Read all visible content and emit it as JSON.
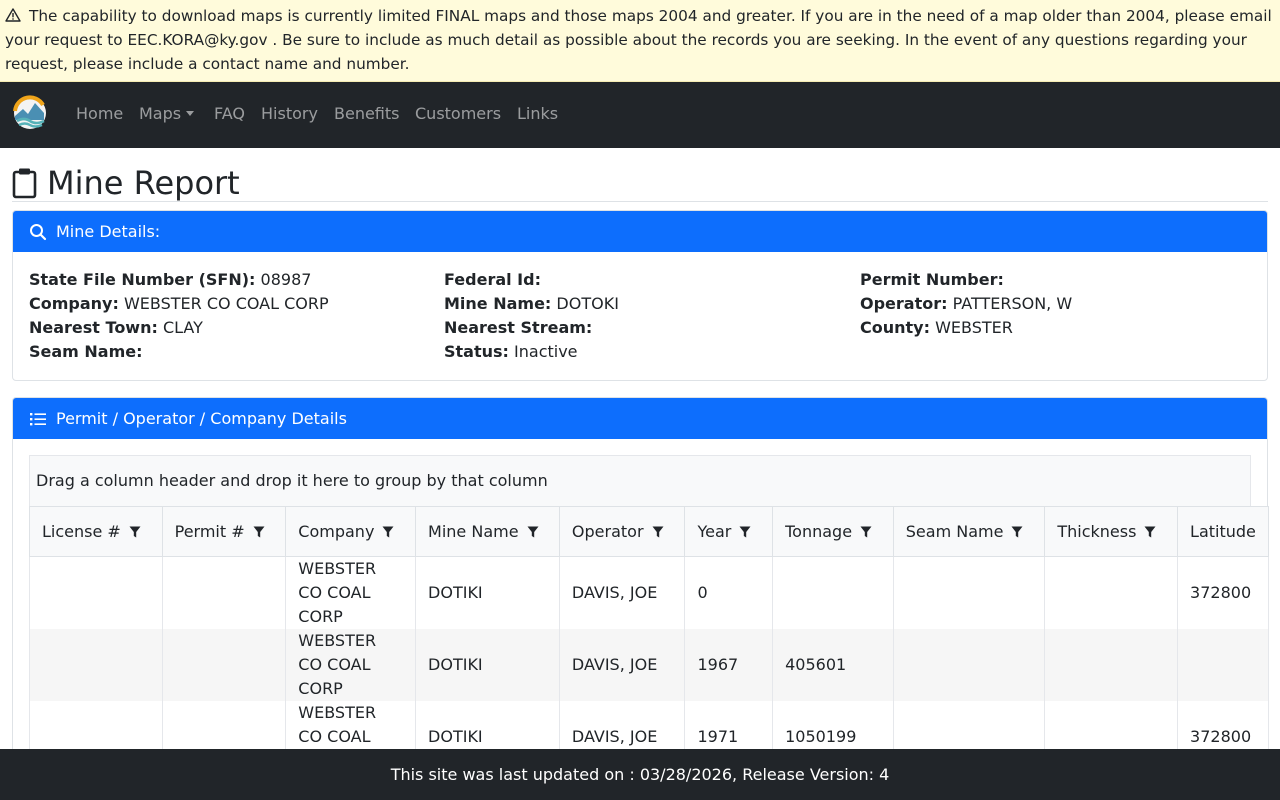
{
  "alert": {
    "icon": "warning-triangle-icon",
    "text": "The capability to download maps is currently limited FINAL maps and those maps 2004 and greater. If you are in the need of a map older than 2004, please email your request to EEC.KORA@ky.gov . Be sure to include as much detail as possible about the records you are seeking. In the event of any questions regarding your request, please include a contact name and number."
  },
  "nav": {
    "items": [
      {
        "label": "Home"
      },
      {
        "label": "Maps"
      },
      {
        "label": "FAQ"
      },
      {
        "label": "History"
      },
      {
        "label": "Benefits"
      },
      {
        "label": "Customers"
      },
      {
        "label": "Links"
      }
    ]
  },
  "page": {
    "title": "Mine Report",
    "title_icon": "clipboard-icon"
  },
  "mine_details": {
    "header": "Mine Details:",
    "fields": [
      {
        "label": "State File Number (SFN):",
        "value": "08987"
      },
      {
        "label": "Company:",
        "value": "WEBSTER CO COAL CORP"
      },
      {
        "label": "Nearest Town:",
        "value": "CLAY"
      },
      {
        "label": "Seam Name:",
        "value": ""
      },
      {
        "label": "Federal Id:",
        "value": ""
      },
      {
        "label": "Mine Name:",
        "value": "DOTOKI"
      },
      {
        "label": "Nearest Stream:",
        "value": ""
      },
      {
        "label": "Status:",
        "value": "Inactive"
      },
      {
        "label": "Permit Number:",
        "value": ""
      },
      {
        "label": "Operator:",
        "value": "PATTERSON, W"
      },
      {
        "label": "County:",
        "value": "WEBSTER"
      }
    ]
  },
  "permit_section": {
    "header": "Permit / Operator / Company Details",
    "group_panel_text": "Drag a column header and drop it here to group by that column",
    "columns": [
      "License #",
      "Permit #",
      "Company",
      "Mine Name",
      "Operator",
      "Year",
      "Tonnage",
      "Seam Name",
      "Thickness",
      "Latitude"
    ],
    "rows": [
      [
        "",
        "",
        "WEBSTER CO COAL CORP",
        "DOTIKI",
        "DAVIS, JOE",
        "0",
        "",
        "",
        "",
        "372800"
      ],
      [
        "",
        "",
        "WEBSTER CO COAL CORP",
        "DOTIKI",
        "DAVIS, JOE",
        "1967",
        "405601",
        "",
        "",
        ""
      ],
      [
        "",
        "",
        "WEBSTER CO COAL CORP",
        "DOTIKI",
        "DAVIS, JOE",
        "1971",
        "1050199",
        "",
        "",
        "372800"
      ]
    ]
  },
  "footer": {
    "text": "This site was last updated on : 03/28/2026, Release Version: 4"
  },
  "colors": {
    "alert_bg": "#fffbdb",
    "navbar_bg": "#212529",
    "card_header_bg": "#0d6efd",
    "footer_bg": "#212529"
  }
}
